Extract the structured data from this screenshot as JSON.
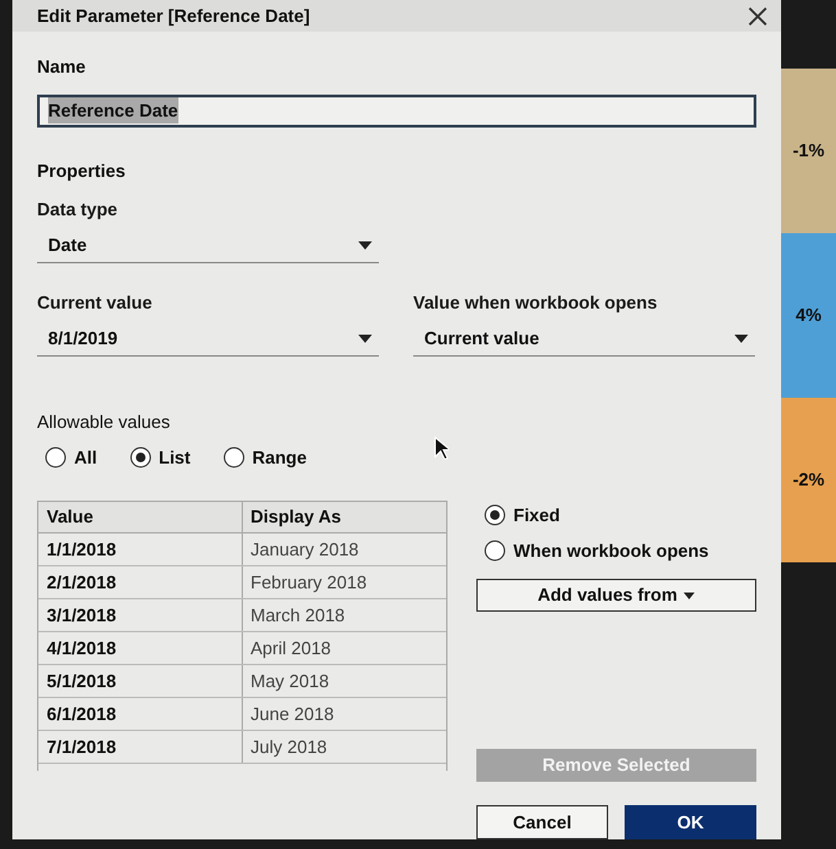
{
  "dialog": {
    "title": "Edit Parameter [Reference Date]",
    "name": {
      "label": "Name",
      "value": "Reference Date"
    },
    "properties_heading": "Properties",
    "data_type": {
      "label": "Data type",
      "value": "Date"
    },
    "current_value": {
      "label": "Current value",
      "value": "8/1/2019"
    },
    "value_when_opens": {
      "label": "Value when workbook opens",
      "value": "Current value"
    },
    "allowable_values": {
      "label": "Allowable values",
      "options": [
        {
          "label": "All",
          "selected": false
        },
        {
          "label": "List",
          "selected": true
        },
        {
          "label": "Range",
          "selected": false
        }
      ]
    },
    "table": {
      "columns": [
        "Value",
        "Display As"
      ],
      "rows": [
        [
          "1/1/2018",
          "January 2018"
        ],
        [
          "2/1/2018",
          "February 2018"
        ],
        [
          "3/1/2018",
          "March 2018"
        ],
        [
          "4/1/2018",
          "April 2018"
        ],
        [
          "5/1/2018",
          "May 2018"
        ],
        [
          "6/1/2018",
          "June 2018"
        ],
        [
          "7/1/2018",
          "July 2018"
        ]
      ]
    },
    "list_source": [
      {
        "label": "Fixed",
        "selected": true
      },
      {
        "label": "When workbook opens",
        "selected": false
      }
    ],
    "add_values_button": "Add values from",
    "remove_button": {
      "label": "Remove Selected",
      "disabled": true
    },
    "buttons": [
      {
        "label": "Cancel",
        "kind": "secondary"
      },
      {
        "label": "OK",
        "kind": "primary"
      }
    ]
  },
  "background": {
    "labels": [
      "-1%",
      "4%",
      "-2%"
    ]
  }
}
